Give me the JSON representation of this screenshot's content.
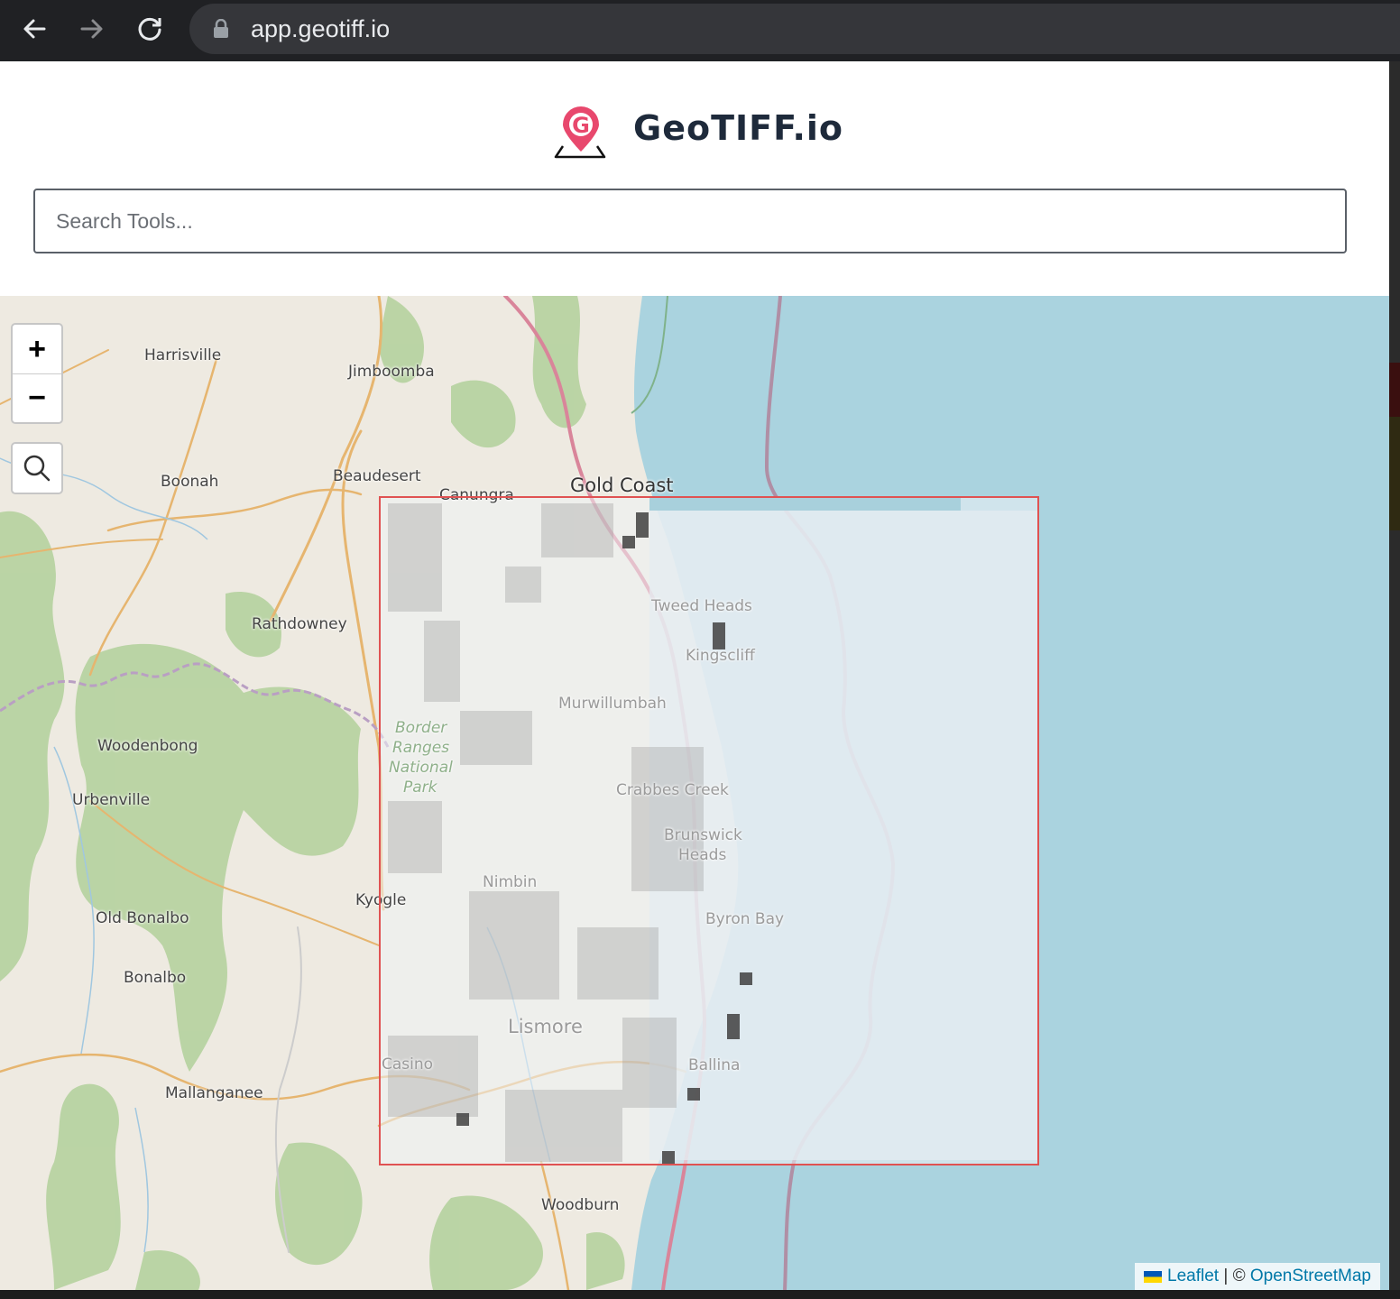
{
  "browser": {
    "url": "app.geotiff.io"
  },
  "header": {
    "brand": "GeoTIFF.io",
    "logo_letter": "G"
  },
  "search": {
    "placeholder": "Search Tools..."
  },
  "map": {
    "zoom_in": "+",
    "zoom_out": "−",
    "places": {
      "harrisville": "Harrisville",
      "jimboomba": "Jimboomba",
      "boonah": "Boonah",
      "beaudesert": "Beaudesert",
      "canungra": "Canungra",
      "gold_coast": "Gold Coast",
      "rathdowney": "Rathdowney",
      "woodenbong": "Woodenbong",
      "urbenville": "Urbenville",
      "old_bonalbo": "Old Bonalbo",
      "bonalbo": "Bonalbo",
      "mallanganee": "Mallanganee",
      "kyogle": "Kyogle",
      "woodburn": "Woodburn",
      "tweed_heads": "Tweed Heads",
      "kingscliff": "Kingscliff",
      "murwillumbah": "Murwillumbah",
      "border_ranges_1": "Border",
      "border_ranges_2": "Ranges",
      "border_ranges_3": "National",
      "border_ranges_4": "Park",
      "crabbes_creek": "Crabbes Creek",
      "brunswick_1": "Brunswick",
      "brunswick_2": "Heads",
      "nimbin": "Nimbin",
      "byron_bay": "Byron Bay",
      "lismore": "Lismore",
      "casino": "Casino",
      "ballina": "Ballina"
    },
    "attribution": {
      "leaflet": "Leaflet",
      "sep": " | © ",
      "osm": "OpenStreetMap"
    }
  },
  "colors": {
    "ocean": "#aad3df",
    "land": "#eeeae1",
    "forest": "#b5d29f",
    "geotiff_border": "#e05252",
    "brand": "#1e2a3b",
    "logo_pink": "#e8486d"
  }
}
